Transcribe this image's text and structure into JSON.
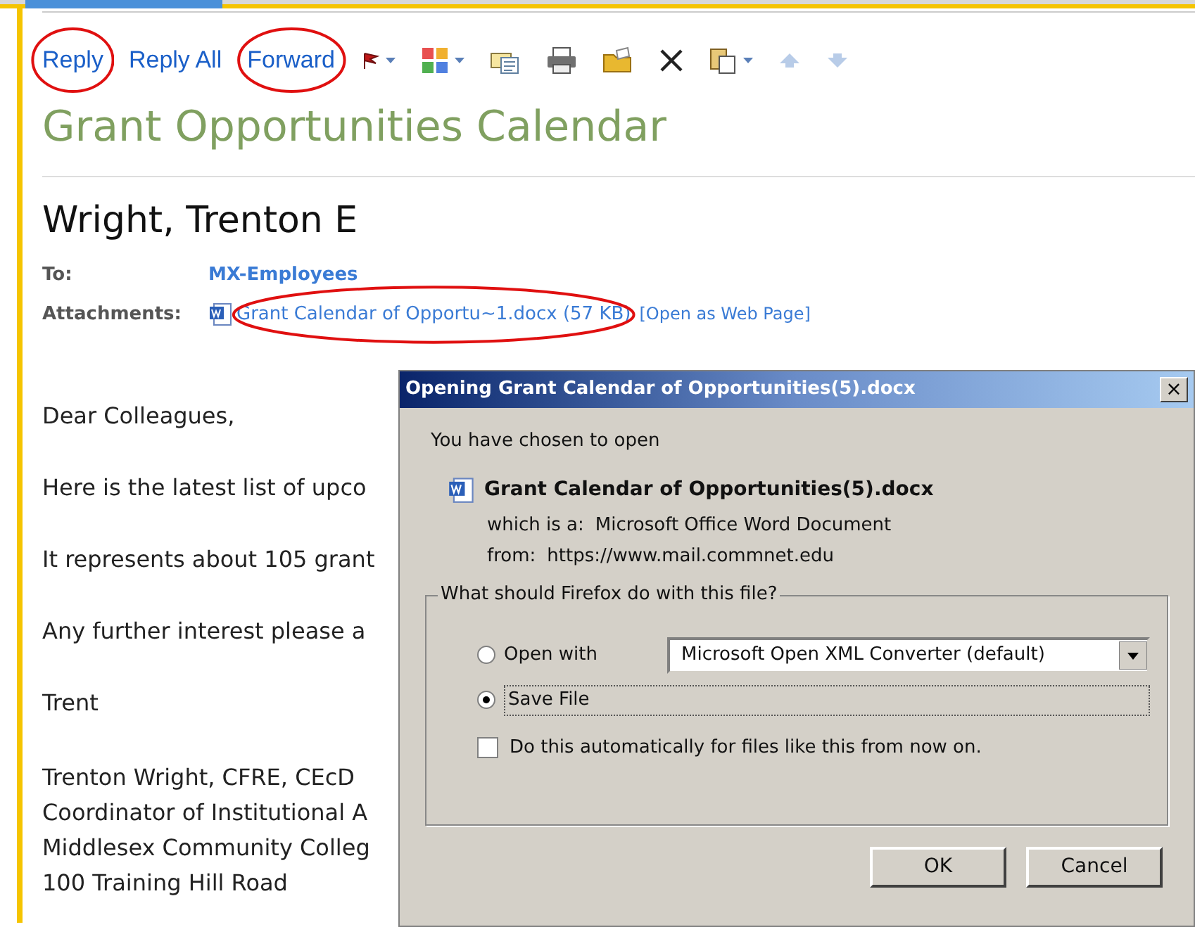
{
  "toolbar": {
    "actions": [
      {
        "label": "Reply",
        "circled": true
      },
      {
        "label": "Reply All",
        "circled": false
      },
      {
        "label": "Forward",
        "circled": true
      }
    ]
  },
  "message": {
    "subject": "Grant Opportunities Calendar",
    "sender": "Wright, Trenton E",
    "to_label": "To:",
    "to": "MX-Employees",
    "attachments_label": "Attachments:",
    "attachment": "Grant Calendar of Opportu~1.docx (57 KB)",
    "attachment_circled": true,
    "open_as_web": "[Open as Web Page]",
    "body": [
      [
        "Dear Colleagues,"
      ],
      [
        "Here is the latest list of upco"
      ],
      [
        "It represents about 105 grant"
      ],
      [
        "Any further interest please a"
      ],
      [
        "Trent"
      ],
      [
        "Trenton Wright, CFRE, CEcD",
        "Coordinator of Institutional A",
        "Middlesex Community Colleg",
        "100 Training Hill Road"
      ]
    ]
  },
  "dialog": {
    "title": "Opening Grant Calendar of Opportunities(5).docx",
    "close": "×",
    "intro": "You have chosen to open",
    "file_name": "Grant Calendar of Opportunities(5).docx",
    "type_label": "which is a:",
    "type": "Microsoft Office Word Document",
    "from_label": "from:",
    "from": "https://www.mail.commnet.edu",
    "group_label": "What should Firefox do with this file?",
    "options": [
      {
        "label": "Open with",
        "selected": false,
        "app": "Microsoft Open XML Converter (default)"
      },
      {
        "label": "Save File",
        "selected": true
      }
    ],
    "auto": {
      "label": "Do this automatically for files like this from now on.",
      "checked": false
    },
    "buttons": [
      "OK",
      "Cancel"
    ]
  }
}
